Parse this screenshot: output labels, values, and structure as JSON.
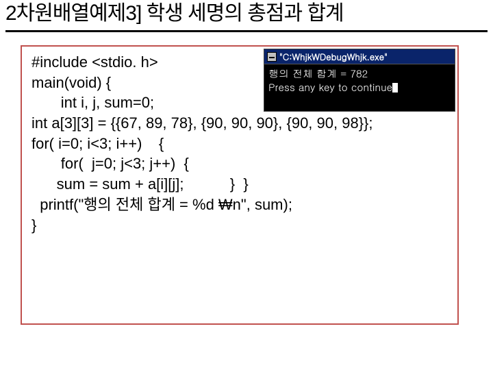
{
  "title": "2차원배열예제3] 학생 세명의 총점과 합계",
  "code": {
    "l1": "#include <stdio. h>",
    "l2": "main(void) {",
    "l3": "       int i, j, sum=0;",
    "l4": "",
    "l5": "int a[3][3] = {{67, 89, 78}, {90, 90, 90}, {90, 90, 98}};",
    "l6": "",
    "l7": "for( i=0; i<3; i++)    {",
    "l8": "       for(  j=0; j<3; j++)  {",
    "l9": "",
    "l10": "      sum = sum + a[i][j];           }  }",
    "l11": "",
    "l12": "  printf(\"행의 전체 합계 = %d ₩n\", sum);",
    "l13": "}"
  },
  "console": {
    "title": "\"C:WhjkWDebugWhjk.exe\"",
    "line1": "행의 전체 합계 = 782",
    "line2": "Press any key to continue"
  }
}
